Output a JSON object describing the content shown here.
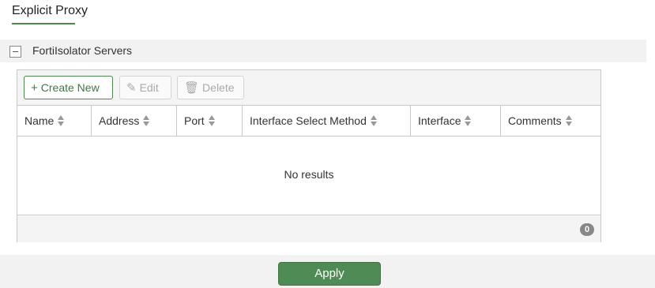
{
  "tab": {
    "title": "Explicit Proxy"
  },
  "section": {
    "title": "FortiIsolator Servers"
  },
  "toolbar": {
    "create_label": "Create New",
    "edit_label": "Edit",
    "delete_label": "Delete"
  },
  "table": {
    "columns": [
      "Name",
      "Address",
      "Port",
      "Interface Select Method",
      "Interface",
      "Comments"
    ],
    "empty_text": "No results",
    "count": "0"
  },
  "footer": {
    "apply_label": "Apply"
  },
  "colors": {
    "accent": "#4f8c55"
  }
}
